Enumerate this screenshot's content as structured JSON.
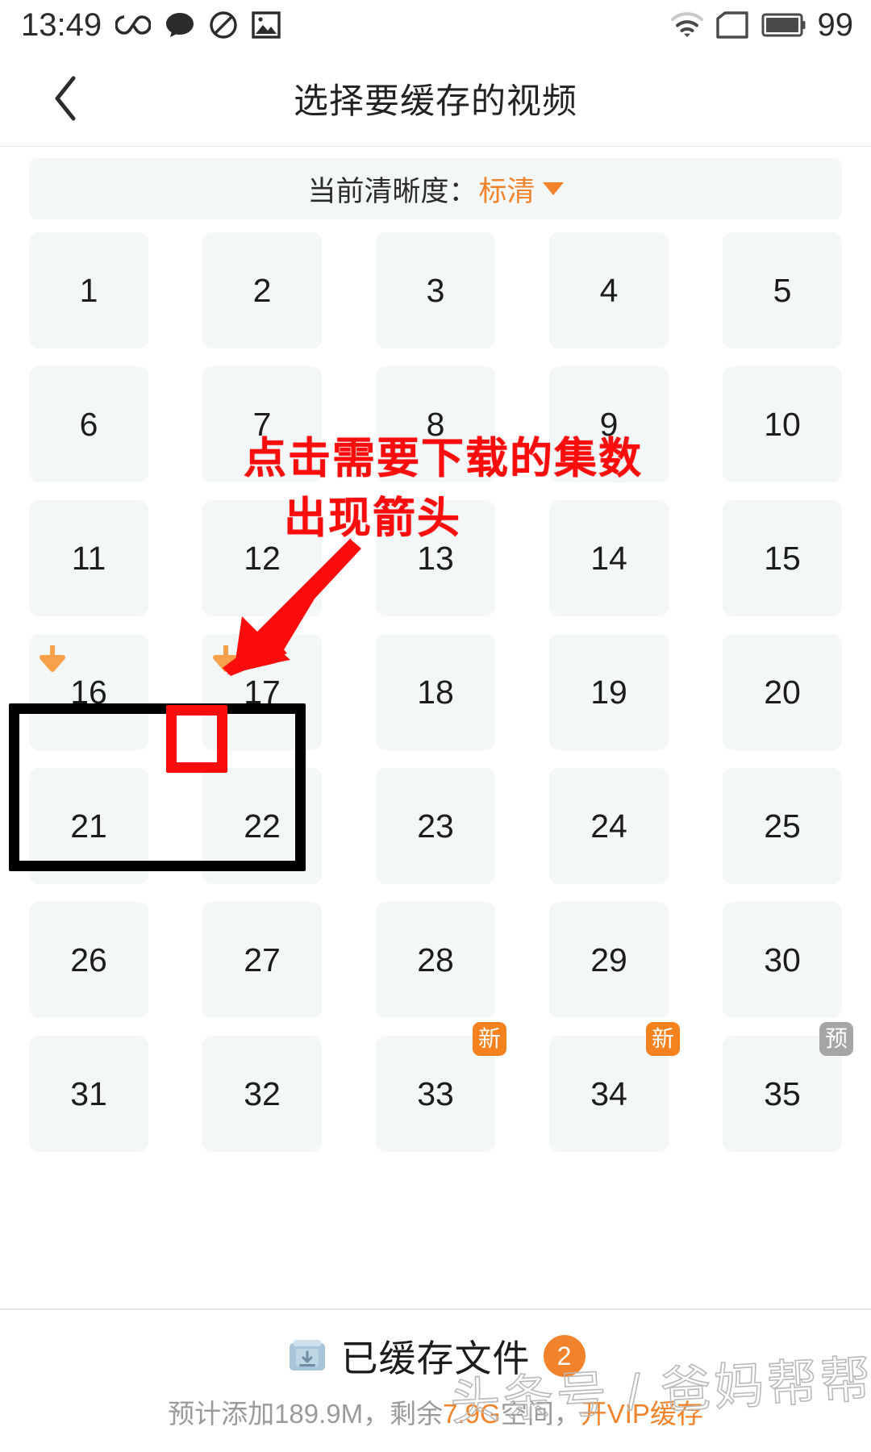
{
  "status_bar": {
    "time": "13:49",
    "battery_level": "99",
    "left_icons": [
      "infinity-icon",
      "chat-bubble-icon",
      "do-not-disturb-icon",
      "image-icon"
    ],
    "right_icons": [
      "wifi-icon",
      "sim-card-icon",
      "battery-icon"
    ]
  },
  "header": {
    "back_icon": "chevron-left-icon",
    "title": "选择要缓存的视频"
  },
  "quality": {
    "label": "当前清晰度：",
    "value": "标清",
    "caret_icon": "caret-down-icon",
    "accent_color": "#f2832a"
  },
  "grid": {
    "columns": 5,
    "cell_bg": "#f3f7f8",
    "episodes": [
      {
        "num": "1"
      },
      {
        "num": "2"
      },
      {
        "num": "3"
      },
      {
        "num": "4"
      },
      {
        "num": "5"
      },
      {
        "num": "6"
      },
      {
        "num": "7"
      },
      {
        "num": "8"
      },
      {
        "num": "9"
      },
      {
        "num": "10"
      },
      {
        "num": "11"
      },
      {
        "num": "12"
      },
      {
        "num": "13"
      },
      {
        "num": "14"
      },
      {
        "num": "15"
      },
      {
        "num": "16",
        "download": true
      },
      {
        "num": "17",
        "download": true
      },
      {
        "num": "18"
      },
      {
        "num": "19"
      },
      {
        "num": "20"
      },
      {
        "num": "21"
      },
      {
        "num": "22"
      },
      {
        "num": "23"
      },
      {
        "num": "24"
      },
      {
        "num": "25"
      },
      {
        "num": "26"
      },
      {
        "num": "27"
      },
      {
        "num": "28"
      },
      {
        "num": "29"
      },
      {
        "num": "30"
      },
      {
        "num": "31"
      },
      {
        "num": "32"
      },
      {
        "num": "33",
        "badge": "新",
        "badge_kind": "new"
      },
      {
        "num": "34",
        "badge": "新",
        "badge_kind": "new"
      },
      {
        "num": "35",
        "badge": "预",
        "badge_kind": "pre"
      }
    ]
  },
  "annotations": {
    "color": "#fc0d0d",
    "line1": "点击需要下载的集数",
    "line2": "出现箭头",
    "highlight_box_color": "#000000",
    "focus_box_color": "#fc0d0d",
    "arrow_icon": "red-pointer-arrow"
  },
  "footer": {
    "cache_icon": "download-tray-icon",
    "cached_files_label": "已缓存文件",
    "cached_count": "2",
    "summary_prefix": "预计添加189.9M，剩余",
    "summary_highlight": "7.9G",
    "summary_suffix": "空间，",
    "summary_link": "开VIP缓存",
    "accent_color": "#f2832a"
  },
  "watermark": {
    "text": "头条号 / 爸妈帮帮帮"
  }
}
